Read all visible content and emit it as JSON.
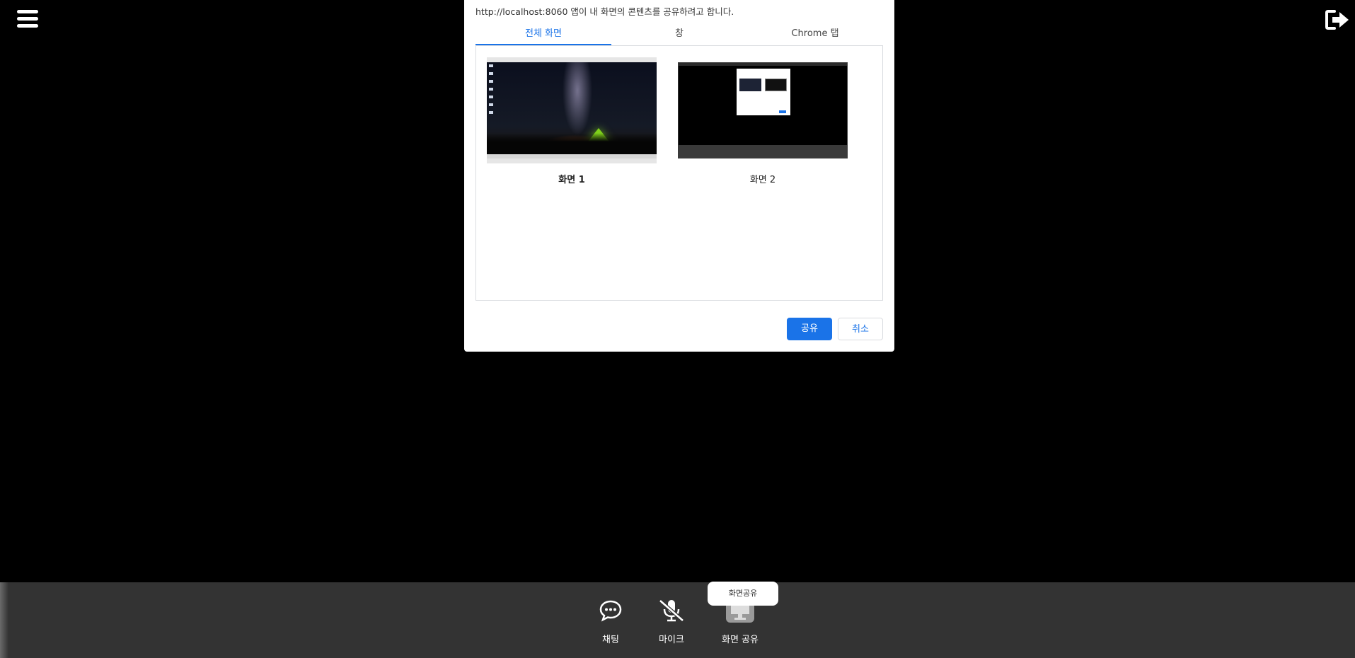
{
  "topbar": {
    "menu_icon": "hamburger-menu-icon",
    "logout_icon": "logout-icon"
  },
  "dialog": {
    "message": "http://localhost:8060 앱이 내 화면의 콘텐츠를 공유하려고 합니다.",
    "tabs": [
      {
        "label": "전체 화면",
        "active": true
      },
      {
        "label": "창",
        "active": false
      },
      {
        "label": "Chrome 탭",
        "active": false
      }
    ],
    "sources": [
      {
        "label": "화면 1",
        "selected": true
      },
      {
        "label": "화면 2",
        "selected": false
      }
    ],
    "share_label": "공유",
    "cancel_label": "취소",
    "accent_color": "#1a73e8"
  },
  "bottombar": {
    "chat_label": "채팅",
    "mic_label": "마이크",
    "screen_share_label": "화면 공유",
    "tooltip": "화면공유"
  }
}
